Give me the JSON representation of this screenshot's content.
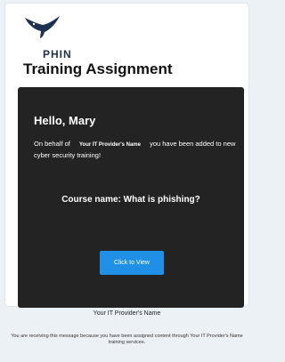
{
  "brand": {
    "logo_icon": "manta-ray-icon",
    "name": "PHIN",
    "color": "#1d3150"
  },
  "email": {
    "title": "Training Assignment",
    "greeting": "Hello, Mary",
    "intro_before": "On behalf of",
    "provider_placeholder": "Your IT Provider's Name",
    "intro_after": "you have been added to new cyber security training!",
    "course_name": "Course name: What is phishing?",
    "cta_label": "Click to View",
    "cta_color": "#1f90e6",
    "panel_color": "#232323"
  },
  "footer": {
    "provider_name": "Your IT Provider's Name",
    "note": "You are receiving this message because you have been assigned content through Your IT Provider's Name training services."
  }
}
